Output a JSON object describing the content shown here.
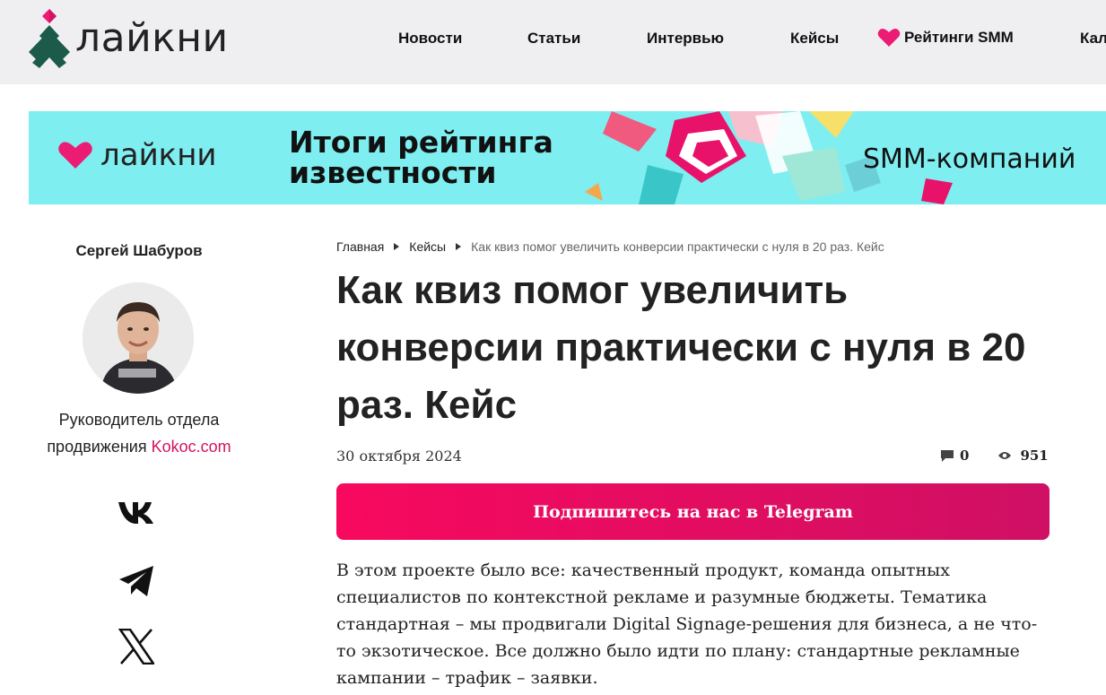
{
  "header": {
    "logo_text": "лайкни",
    "nav": [
      {
        "label": "Новости"
      },
      {
        "label": "Статьи"
      },
      {
        "label": "Интервью"
      },
      {
        "label": "Кейсы"
      },
      {
        "label": "Рейтинги SMM"
      },
      {
        "label": "Кал"
      }
    ]
  },
  "banner": {
    "logo_text": "лайкни",
    "title_line1": "Итоги рейтинга",
    "title_line2": "известности",
    "subtitle": "SMM-компаний"
  },
  "author": {
    "name": "Сергей Шабуров",
    "role_line1": "Руководитель отдела",
    "role_prefix": "продвижения",
    "company": "Kokoc.com"
  },
  "social": [
    "vk-icon",
    "telegram-icon",
    "x-icon"
  ],
  "breadcrumbs": {
    "home": "Главная",
    "section": "Кейсы",
    "current": "Как квиз помог увеличить конверсии практически с нуля в 20 раз. Кейс"
  },
  "article": {
    "title": "Как квиз помог увеличить конверсии практически с нуля в 20 раз. Кейс",
    "date": "30 октября 2024",
    "comments": "0",
    "views": "951",
    "cta": "Подпишитесь на нас в Telegram",
    "lead": "В этом проекте было все: качественный продукт, команда опытных специалистов по контекстной рекламе и разумные бюджеты. Тематика стандартная – мы продвигали Digital Signage-решения для бизнеса, а не что-то экзотическое. Все должно было идти по плану: стандартные рекламные кампании – трафик – заявки."
  },
  "colors": {
    "accent": "#e8126a",
    "header_bg": "#efeff2",
    "banner_bg": "#7eeef0",
    "logo_green": "#1c5a4a"
  }
}
